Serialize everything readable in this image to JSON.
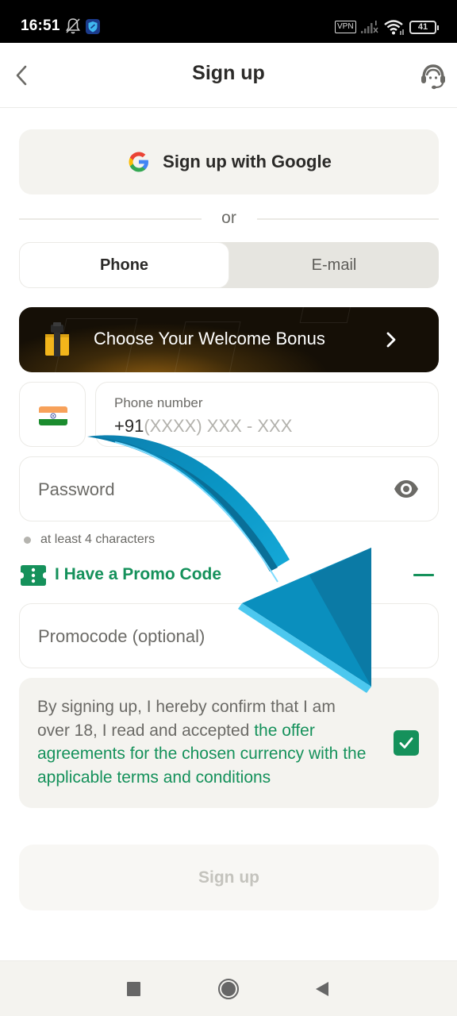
{
  "status_bar": {
    "time": "16:51",
    "vpn_label": "VPN",
    "battery_level": "41",
    "icons": [
      "notifications-off-icon",
      "shield-app-icon",
      "vpn-icon",
      "signal-icon",
      "wifi-icon",
      "battery-icon"
    ]
  },
  "header": {
    "title": "Sign up",
    "back_icon": "chevron-left-icon",
    "support_icon": "headset-support-icon"
  },
  "google_button": {
    "label": "Sign up with Google",
    "icon": "google-g-icon"
  },
  "divider": {
    "label": "or"
  },
  "method_tabs": {
    "tabs": [
      {
        "label": "Phone",
        "selected": true
      },
      {
        "label": "E-mail",
        "selected": false
      }
    ]
  },
  "bonus_banner": {
    "label": "Choose Your Welcome Bonus",
    "icon": "gift-box-icon",
    "chevron_icon": "chevron-right-icon"
  },
  "phone_input": {
    "country_flag": "india-flag-icon",
    "label": "Phone number",
    "prefix": "+91",
    "placeholder": "(XXXX) XXX - XXX"
  },
  "password_input": {
    "placeholder": "Password",
    "toggle_icon": "eye-icon",
    "hint": "at least 4 characters"
  },
  "promo": {
    "toggle_label": "I Have a Promo Code",
    "ticket_icon": "ticket-icon",
    "collapse_icon": "minus-icon",
    "placeholder": "Promocode (optional)"
  },
  "terms": {
    "text_plain": "By signing up, I hereby confirm that I am over 18, I read and accepted ",
    "text_link": "the offer agreements for the chosen currency with the applicable terms and conditions",
    "checked": true
  },
  "submit": {
    "label": "Sign up",
    "enabled": false
  },
  "nav_bar": {
    "buttons": [
      "recents-square-icon",
      "home-circle-icon",
      "back-triangle-icon"
    ]
  },
  "colors": {
    "accent_green": "#15915b",
    "surface": "#f4f3ef",
    "text_primary": "#2b2a28",
    "text_secondary": "#6b6a66",
    "annotation_arrow": "#1a9ccc"
  }
}
